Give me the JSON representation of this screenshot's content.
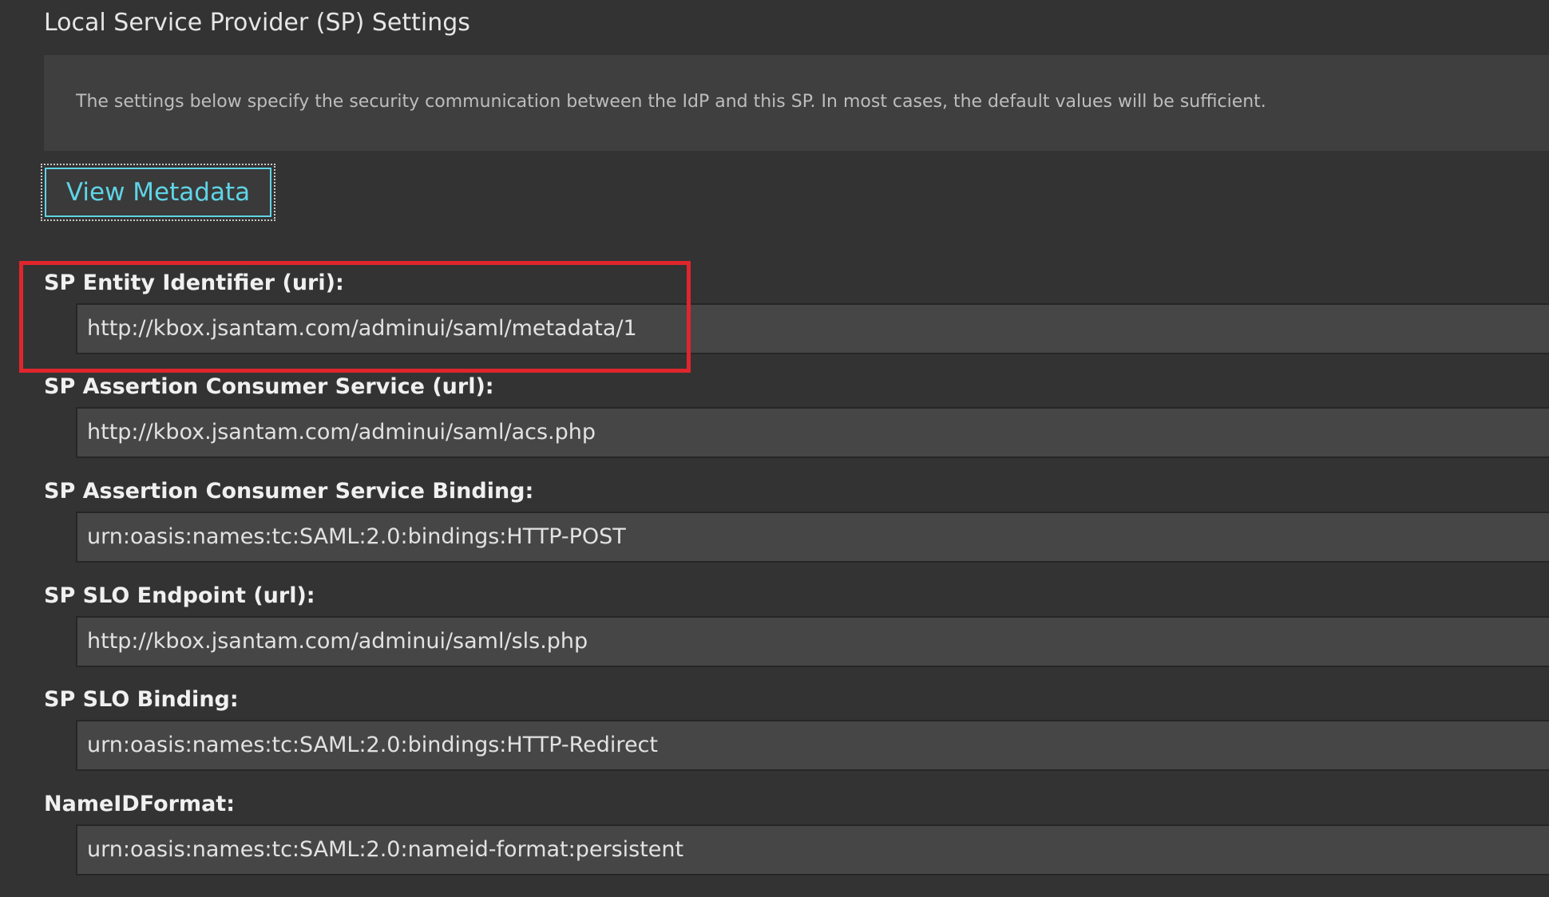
{
  "section": {
    "title": "Local Service Provider (SP) Settings",
    "info": "The settings below specify the security communication between the IdP and this SP. In most cases, the default values will be sufficient."
  },
  "buttons": {
    "view_metadata": "View Metadata"
  },
  "fields": [
    {
      "label": "SP Entity Identifier (uri):",
      "value": "http://kbox.jsantam.com/adminui/saml/metadata/1"
    },
    {
      "label": "SP Assertion Consumer Service (url):",
      "value": "http://kbox.jsantam.com/adminui/saml/acs.php"
    },
    {
      "label": "SP Assertion Consumer Service Binding:",
      "value": "urn:oasis:names:tc:SAML:2.0:bindings:HTTP-POST"
    },
    {
      "label": "SP SLO Endpoint (url):",
      "value": "http://kbox.jsantam.com/adminui/saml/sls.php"
    },
    {
      "label": "SP SLO Binding:",
      "value": "urn:oasis:names:tc:SAML:2.0:bindings:HTTP-Redirect"
    },
    {
      "label": "NameIDFormat:",
      "value": "urn:oasis:names:tc:SAML:2.0:nameid-format:persistent"
    }
  ],
  "colors": {
    "background": "#333333",
    "accent": "#5fd4e6",
    "highlight": "#e0262c"
  }
}
